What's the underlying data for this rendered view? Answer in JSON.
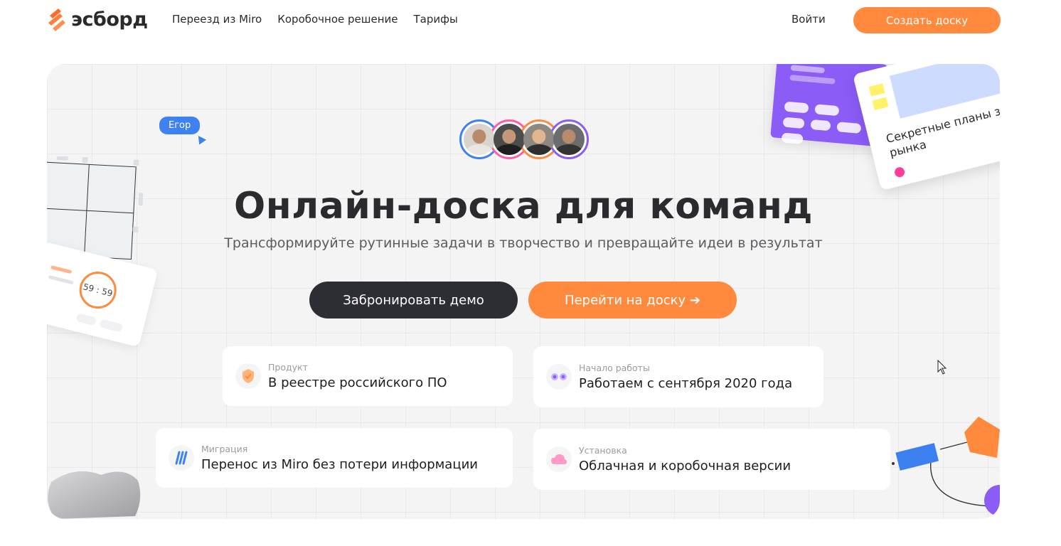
{
  "header": {
    "logo_text": "эсборд",
    "nav": [
      "Переезд из Miro",
      "Коробочное решение",
      "Тарифы"
    ],
    "login": "Войти",
    "cta": "Создать доску"
  },
  "hero": {
    "title": "Онлайн-доска для команд",
    "subtitle": "Трансформируйте рутинные задачи в творчество и превращайте идеи в результат",
    "btn_demo": "Забронировать демо",
    "btn_board": "Перейти на доску ➔",
    "user_tag": "Егор",
    "timer": "59 : 59",
    "note_title": "Секретные планы за рынка"
  },
  "features": [
    {
      "label": "Продукт",
      "value": "В реестре российского ПО",
      "icon": "shield-icon"
    },
    {
      "label": "Начало работы",
      "value": "Работаем с сентября 2020 года",
      "icon": "eyes-icon"
    },
    {
      "label": "Миграция",
      "value": "Перенос из Miro без потери информации",
      "icon": "miro-icon"
    },
    {
      "label": "Установка",
      "value": "Облачная и коробочная версии",
      "icon": "cloud-icon"
    }
  ],
  "colors": {
    "accent": "#ff8a3d",
    "dark": "#2d2e33",
    "avatar_rings": [
      "#3d82f0",
      "#ff5fa2",
      "#ff8a3d",
      "#8b5cf6"
    ]
  }
}
